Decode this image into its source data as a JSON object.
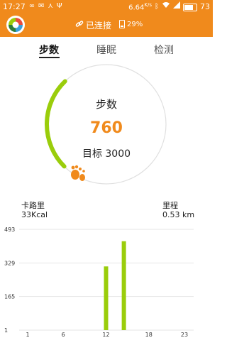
{
  "status_bar": {
    "time": "17:27",
    "net_speed": "6.64",
    "net_unit": "K/s",
    "battery": "73",
    "icons": [
      "loop-icon",
      "mail-icon",
      "share-icon",
      "usb-icon",
      "bluetooth-icon",
      "wifi-icon",
      "signal-icon",
      "battery-icon"
    ]
  },
  "app_bar": {
    "connection_text": "已连接",
    "device_battery": "29%",
    "icons": [
      "app-logo",
      "link-icon",
      "battery-icon"
    ]
  },
  "tabs": [
    {
      "label": "步数",
      "active": true
    },
    {
      "label": "睡眠",
      "active": false
    },
    {
      "label": "检测",
      "active": false
    }
  ],
  "ring": {
    "title": "步数",
    "steps": "760",
    "goal_text": "目标 3000",
    "progress": 0.253,
    "accent": "#9acd0b",
    "value_color": "#f08a1c",
    "icon": "footprint-icon"
  },
  "stats": {
    "calories_label": "卡路里",
    "calories_value": "33Kcal",
    "distance_label": "里程",
    "distance_value": "0.53 km"
  },
  "chart_data": {
    "type": "bar",
    "x_ticks": [
      "1",
      "6",
      "12",
      "18",
      "23"
    ],
    "y_ticks": [
      "493",
      "329",
      "165",
      "1"
    ],
    "ylim": [
      1,
      493
    ],
    "xlim": [
      0,
      24
    ],
    "bars": [
      {
        "hour": 12,
        "value": 312
      },
      {
        "hour": 14.5,
        "value": 435
      }
    ],
    "bar_color": "#9acd0b",
    "grid": true
  }
}
